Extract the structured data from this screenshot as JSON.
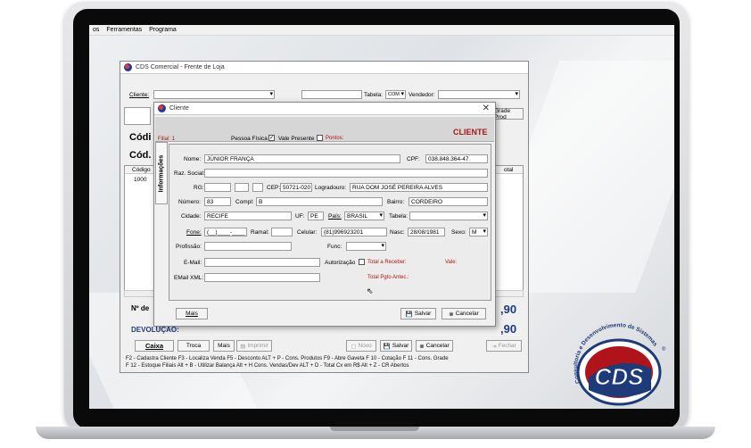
{
  "menu": {
    "items": [
      "os",
      "Ferramentas",
      "Programa"
    ]
  },
  "main_window": {
    "title": "CDS Comercial - Frente de Loja",
    "cliente_label": "Cliente:",
    "tabela_label": "Tabela:",
    "tabela_value": "COM",
    "vendedor_label": "Vendedor:",
    "grade_button": "Grade Prod",
    "cod_label": "Códi",
    "cod2_label": "Cód.",
    "col_codigo": "Código",
    "col_total": "otal",
    "row_codigo": "1000",
    "no_label": "Nº de",
    "devol_label": "DEVOLUÇÃO:",
    "total1": ",90",
    "total2": ",90",
    "btn_caixa": "Caixa",
    "btn_troca": "Troca",
    "btn_mais": "Mais",
    "btn_imprimir": "Imprimir",
    "btn_novo": "Novo",
    "btn_salvar": "Salvar",
    "btn_cancelar": "Cancelar",
    "btn_fechar": "Fechar",
    "hotkeys_line1": "F2 - Cadastra Cliente     F3 - Localiza Venda     F5 - Desconto     ALT + P - Cons. Produtos     F9 - Abre Gaveta     F 10 - Cotação     F 11 - Cons. Grade",
    "hotkeys_line2": "F 12 - Estoque Filiais   Alt + B - Utilizar Balança     Alt + H Cons. Vendas/Dev     ALT + D - Total Cx em R$     Alt + Z - CR Abertos"
  },
  "dialog": {
    "title": "Cliente",
    "filial": "Filial: 1",
    "pessoa_fisica": "Pessoa Física",
    "vale_presente": "Vale Presente",
    "pontos": "Pontos:",
    "heading": "CLIENTE",
    "tab_label": "Informações",
    "nome_label": "Nome:",
    "nome_value": "JÚNIOR FRANÇA",
    "cpf_label": "CPF:",
    "cpf_value": "038.848.364-47",
    "razao_label": "Raz. Social:",
    "rg_label": "RG:",
    "cep_label": "CEP:",
    "cep_value": "50721-020",
    "logradouro_label": "Logradouro:",
    "logradouro_value": "RUA DOM JOSÉ PEREIRA ALVES",
    "numero_label": "Número:",
    "numero_value": "83",
    "compl_label": "Compl:",
    "compl_value": "B",
    "bairro_label": "Bairro:",
    "bairro_value": "CORDEIRO",
    "cidade_label": "Cidade:",
    "cidade_value": "RECIFE",
    "uf_label": "UF:",
    "uf_value": "PE",
    "pais_label": "País:",
    "pais_value": "BRASIL",
    "tabela_label": "Tabela:",
    "fone_label": "Fone:",
    "fone_value": "(__)____-____",
    "ramal_label": "Ramal:",
    "celular_label": "Celular:",
    "celular_value": "(81)996923201",
    "nasc_label": "Nasc:",
    "nasc_value": "28/08/1981",
    "sexo_label": "Sexo:",
    "sexo_value": "M",
    "profissao_label": "Profissão:",
    "func_label": "Func:",
    "email_label": "E-Mail:",
    "autorizacao_label": "Autorização",
    "total_receber_label": "Total a Receber:",
    "vale_label": "Vale:",
    "email_xml_label": "EMail XML:",
    "total_pgto_label": "Total Pgto Antec.:",
    "btn_mais": "Mais",
    "btn_salvar": "Salvar",
    "btn_cancelar": "Cancelar"
  },
  "logo": {
    "text": "CDS",
    "ring_text": "Consultoria e Desenvolvimento de Sistemas",
    "registered": "®"
  },
  "colors": {
    "accent_red": "#b0141a",
    "brand_blue": "#1d3a7a"
  }
}
